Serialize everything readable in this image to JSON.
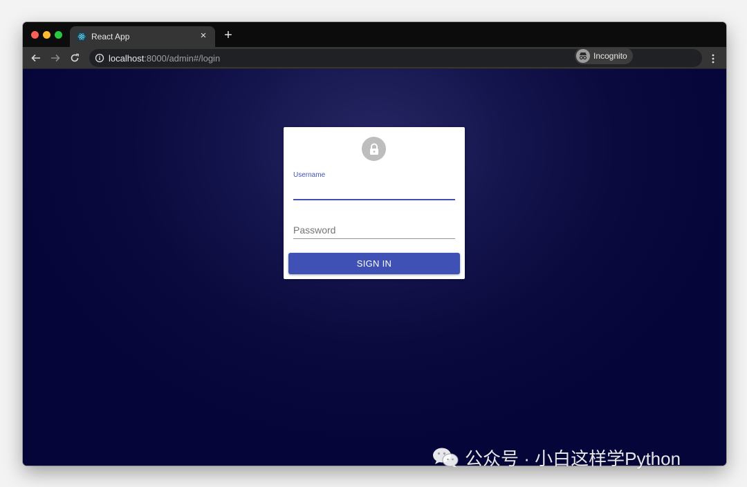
{
  "browser": {
    "tab_title": "React App",
    "new_tab_symbol": "+",
    "close_symbol": "×",
    "url_host": "localhost",
    "url_rest": ":8000/admin#/login",
    "profile_label": "Incognito"
  },
  "login": {
    "username_label": "Username",
    "username_value": "",
    "password_placeholder": "Password",
    "password_value": "",
    "signin_label": "SIGN IN"
  },
  "watermark": {
    "text": "公众号 · 小白这样学Python"
  },
  "colors": {
    "accent": "#3f51b5",
    "page_background": "#0a0a3e",
    "card": "#ffffff",
    "avatar": "#bdbdbd"
  },
  "icons": [
    "react-favicon-icon",
    "back-arrow-icon",
    "forward-arrow-icon",
    "reload-icon",
    "info-icon",
    "star-icon",
    "incognito-icon",
    "menu-icon",
    "lock-icon",
    "wechat-icon"
  ]
}
